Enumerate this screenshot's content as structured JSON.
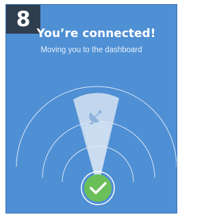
{
  "step": {
    "number": "8"
  },
  "header": {
    "title": "You’re connected!",
    "subtitle": "Moving you to the dashboard"
  },
  "icons": {
    "satellite": "satellite-dish-icon",
    "status": "checkmark-icon"
  },
  "colors": {
    "background": "#4f8fd4",
    "badge": "#2f3e4e",
    "success": "#6bbf59",
    "beam": "#dfe9f4"
  }
}
